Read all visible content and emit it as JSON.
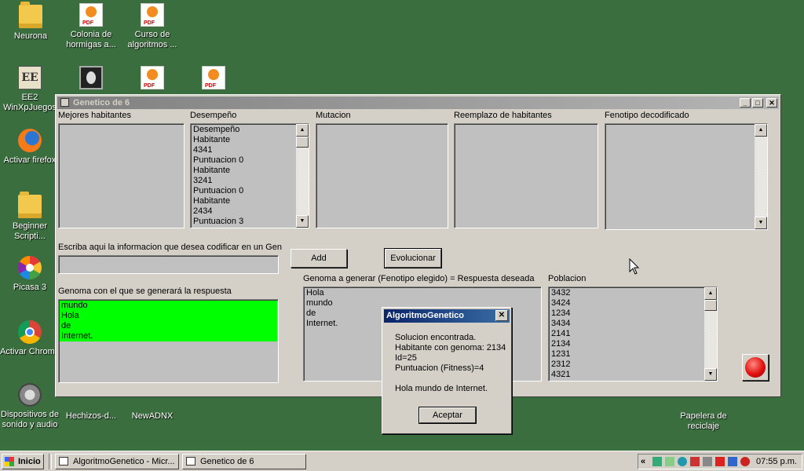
{
  "desktop": {
    "icons": [
      {
        "label": "Neurona"
      },
      {
        "label": "Colonia de hormigas a..."
      },
      {
        "label": "Curso de algoritmos ..."
      },
      {
        "label": "EE2 WinXpJuegos"
      },
      {
        "label": "Activar firefox"
      },
      {
        "label": "Beginner Scripti..."
      },
      {
        "label": "Picasa 3"
      },
      {
        "label": "Activar Chrome"
      },
      {
        "label": "Dispositivos de sonido y audio"
      },
      {
        "label": "Hechizos-d..."
      },
      {
        "label": "NewADNX"
      },
      {
        "label": "Papelera de reciclaje"
      }
    ]
  },
  "window": {
    "title": "Genetico de 6",
    "labels": {
      "mejores": "Mejores habitantes",
      "desempeno": "Desempeño",
      "mutacion": "Mutacion",
      "reemplazo": "Reemplazo de habitantes",
      "fenotipo": "Fenotipo decodificado",
      "escriba": "Escriba aqui la informacion que desea codificar en un Gen",
      "genoma_con": "Genoma con el que se generará la respuesta",
      "genoma_generar": "Genoma a generar (Fenotipo elegido) = Respuesta deseada",
      "poblacion": "Poblacion"
    },
    "buttons": {
      "add": "Add",
      "evolucionar": "Evolucionar"
    },
    "input_value": "",
    "desempeno_list": [
      "Desempeño",
      "Habitante",
      "4341",
      "Puntuacion 0",
      "Habitante",
      "3241",
      "Puntuacion 0",
      "Habitante",
      "2434",
      "Puntuacion 3"
    ],
    "genoma_con_list": [
      "mundo",
      "Hola",
      "de",
      "Internet."
    ],
    "genoma_generar_list": [
      "Hola",
      "mundo",
      "de",
      "Internet."
    ],
    "poblacion_list": [
      "3432",
      "3424",
      "1234",
      "3434",
      "2141",
      "2134",
      "1231",
      "2312",
      "4321"
    ]
  },
  "dialog": {
    "title": "AlgoritmoGenetico",
    "close": "✕",
    "lines": [
      "Solucion encontrada.",
      "Habitante con genoma: 2134",
      "Id=25",
      "Puntuacion (Fitness)=4"
    ],
    "message": "Hola mundo de Internet.",
    "ok": "Aceptar"
  },
  "taskbar": {
    "start": "Inicio",
    "tasks": [
      "AlgoritmoGenetico - Micr...",
      "Genetico de 6"
    ],
    "chevron": "«",
    "clock": "07:55 p.m."
  },
  "colors": {
    "desktop": "#3b6e3f",
    "highlight": "#00ff00",
    "stop_button": "#e01010"
  }
}
